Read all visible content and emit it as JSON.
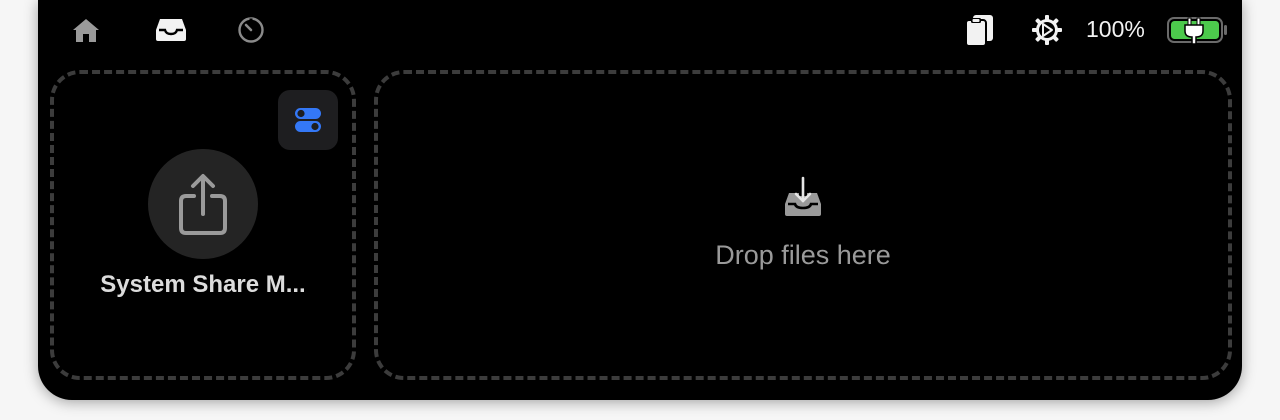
{
  "topbar": {
    "left_icons": [
      "home-icon",
      "tray-icon",
      "timer-icon"
    ],
    "right_icons": [
      "clipboard-icon",
      "gear-icon",
      "battery-icon"
    ],
    "battery_percent": "100%",
    "battery_level": 1.0,
    "battery_color": "#4cc94c",
    "charging": true
  },
  "share_panel": {
    "label": "System Share M...",
    "toggle_icon_color": "#3478f6"
  },
  "drop_panel": {
    "text": "Drop files here"
  }
}
